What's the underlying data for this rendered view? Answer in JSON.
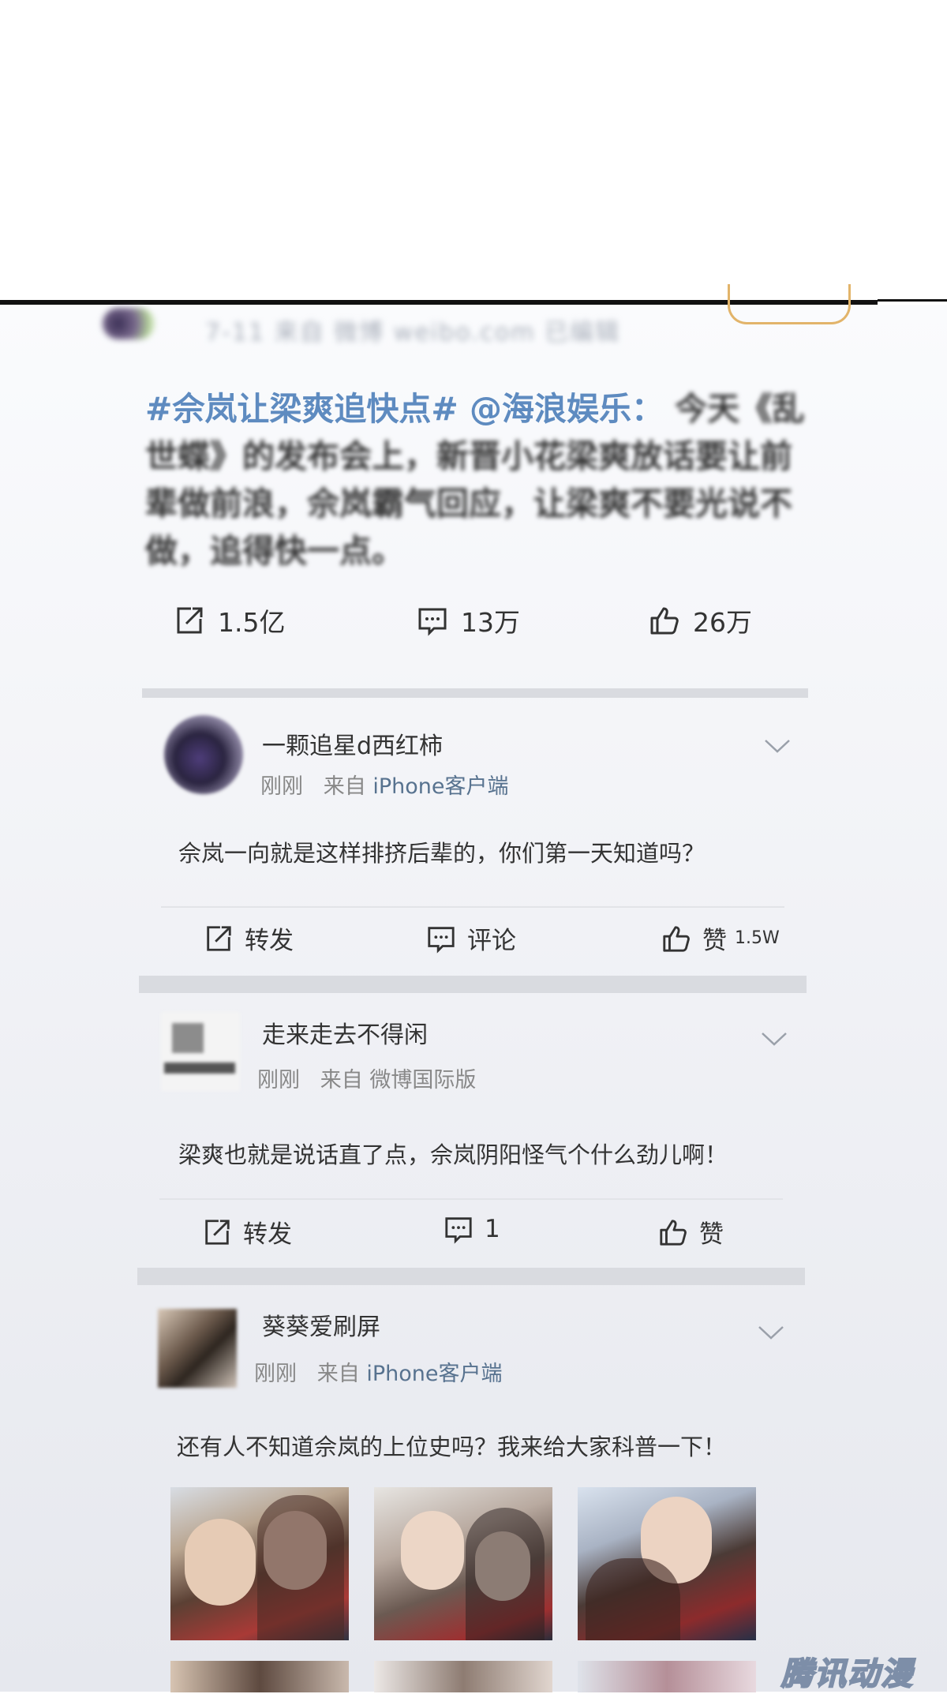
{
  "header_meta_blurred": "7-11 来自 微博 weibo.com 已编辑",
  "post": {
    "topic": "#佘岚让梁爽追快点#",
    "mention": "@海浪娱乐：",
    "body": "今天《乱世蝶》的发布会上，新晋小花梁爽放话要让前辈做前浪，佘岚霸气回应，让梁爽不要光说不做，追得快一点。",
    "stats": {
      "reposts": "1.5亿",
      "comments": "13万",
      "likes": "26万"
    }
  },
  "comments": [
    {
      "username": "一颗追星d西红柿",
      "time": "刚刚",
      "from_label": "来自",
      "source": "iPhone客户端",
      "text": "佘岚一向就是这样排挤后辈的，你们第一天知道吗？",
      "repost_label": "转发",
      "comment_label": "评论",
      "like_label": "赞",
      "like_count": "1.5W"
    },
    {
      "username": "走来走去不得闲",
      "time": "刚刚",
      "from_label": "来自",
      "source": "微博国际版",
      "text": "梁爽也就是说话直了点，佘岚阴阳怪气个什么劲儿啊！",
      "repost_label": "转发",
      "comment_count": "1",
      "like_label": "赞"
    },
    {
      "username": "葵葵爱刷屏",
      "time": "刚刚",
      "from_label": "来自",
      "source": "iPhone客户端",
      "text": "还有人不知道佘岚的上位史吗？我来给大家科普一下！"
    }
  ],
  "watermark": "腾讯动漫",
  "colors": {
    "topic": "#5e8bc0",
    "source": "#57728f",
    "divider": "#d9dbe0",
    "follow_border": "#e2b46a"
  },
  "icons": [
    "repost-icon",
    "comment-icon",
    "like-icon",
    "chevron-down-icon"
  ]
}
